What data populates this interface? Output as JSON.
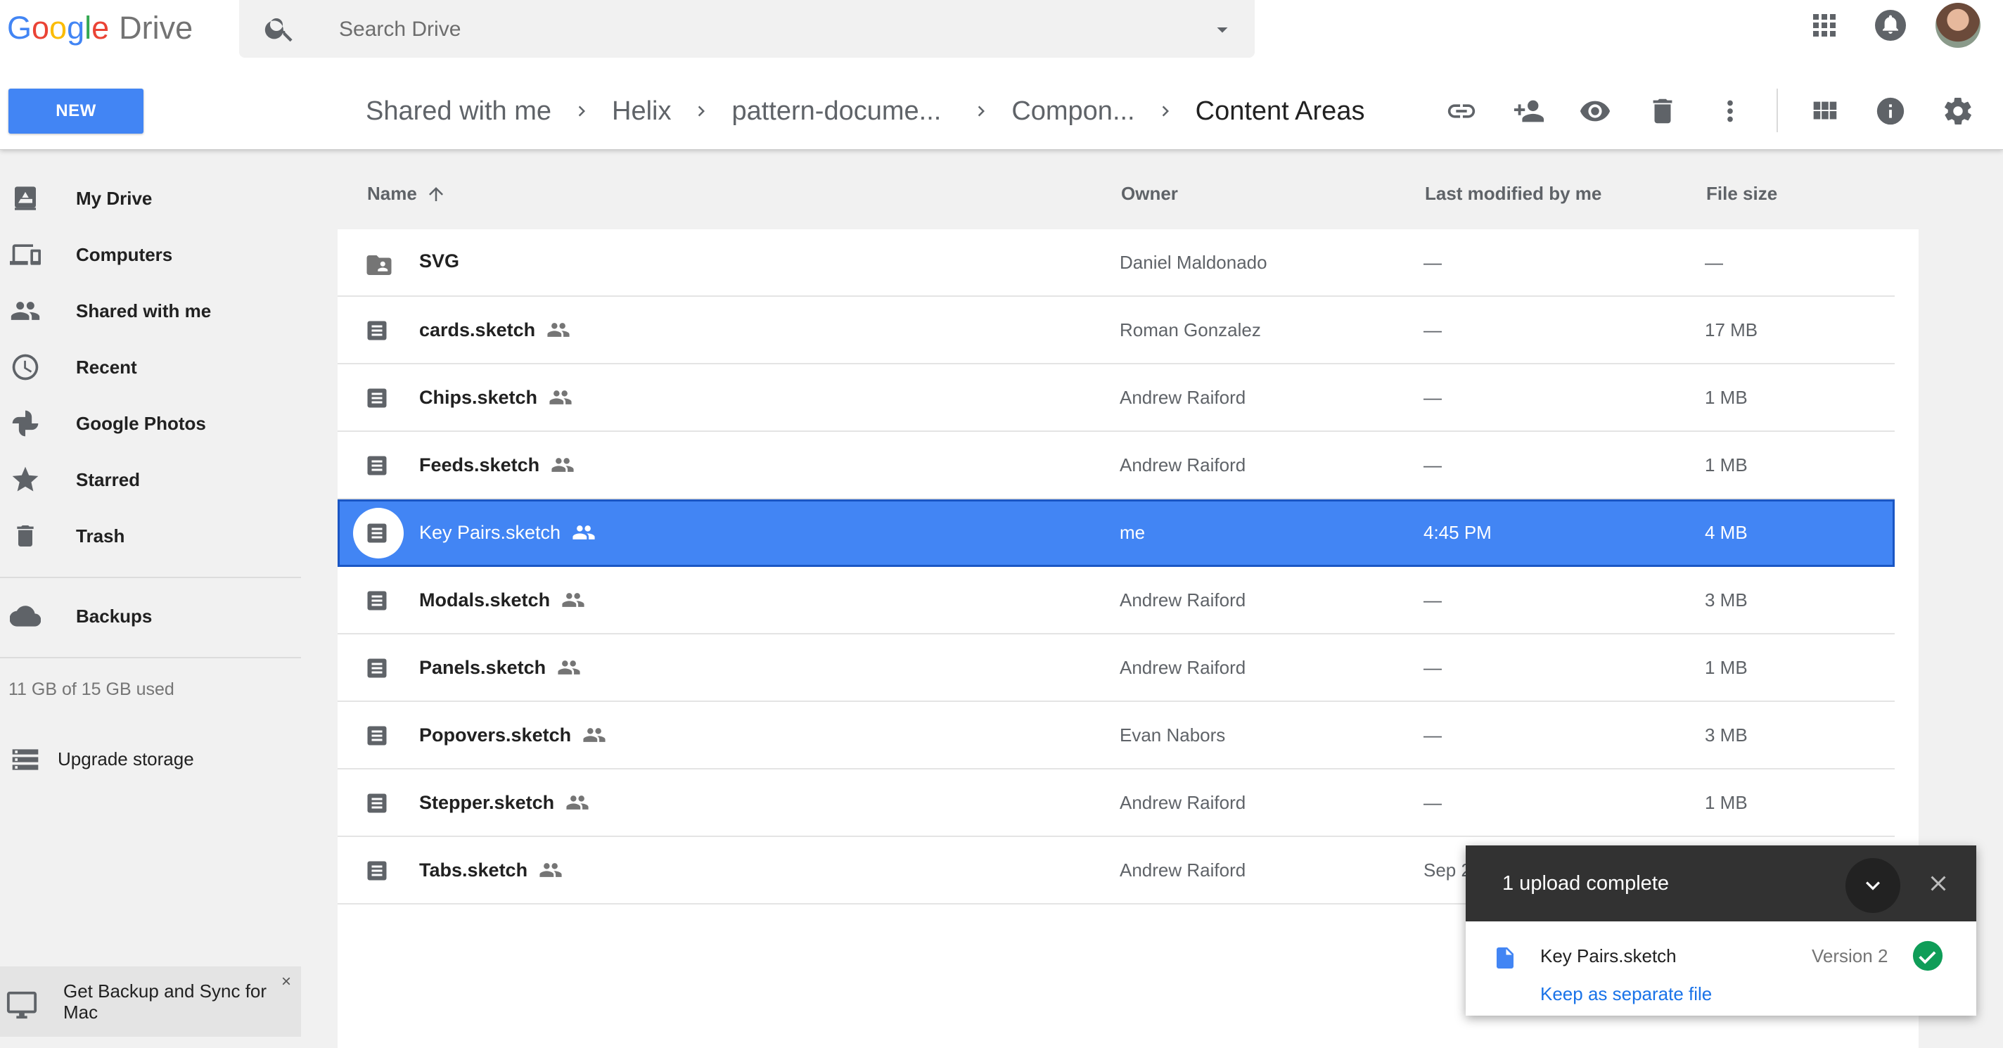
{
  "header": {
    "logo_text": "Google",
    "product_name": "Drive",
    "search_placeholder": "Search Drive"
  },
  "new_button_label": "NEW",
  "breadcrumb": [
    "Shared with me",
    "Helix",
    "pattern-docume...",
    "Compon...",
    "Content Areas"
  ],
  "toolbar_icons": [
    "link-icon",
    "add-person-icon",
    "preview-eye-icon",
    "trash-icon",
    "more-vert-icon",
    "grid-view-icon",
    "info-icon",
    "settings-gear-icon"
  ],
  "top_icons": [
    "apps-grid-icon",
    "notifications-bell-icon",
    "avatar"
  ],
  "sidebar": {
    "items": [
      {
        "label": "My Drive",
        "icon": "my-drive-icon"
      },
      {
        "label": "Computers",
        "icon": "computers-icon"
      },
      {
        "label": "Shared with me",
        "icon": "people-icon"
      },
      {
        "label": "Recent",
        "icon": "clock-icon"
      },
      {
        "label": "Google Photos",
        "icon": "pinwheel-icon"
      },
      {
        "label": "Starred",
        "icon": "star-icon"
      },
      {
        "label": "Trash",
        "icon": "trash-icon"
      }
    ],
    "backups_label": "Backups",
    "storage_text": "11 GB of 15 GB used",
    "upgrade_label": "Upgrade storage",
    "promo_text": "Get Backup and Sync for Mac",
    "promo_close": "×"
  },
  "columns": {
    "name": "Name",
    "owner": "Owner",
    "modified": "Last modified by me",
    "size": "File size"
  },
  "files": [
    {
      "name": "SVG",
      "owner": "Daniel Maldonado",
      "modified": "—",
      "size": "—",
      "type": "shared-folder",
      "shared": false,
      "selected": false
    },
    {
      "name": "cards.sketch",
      "owner": "Roman Gonzalez",
      "modified": "—",
      "size": "17 MB",
      "type": "file",
      "shared": true,
      "selected": false
    },
    {
      "name": "Chips.sketch",
      "owner": "Andrew Raiford",
      "modified": "—",
      "size": "1 MB",
      "type": "file",
      "shared": true,
      "selected": false
    },
    {
      "name": "Feeds.sketch",
      "owner": "Andrew Raiford",
      "modified": "—",
      "size": "1 MB",
      "type": "file",
      "shared": true,
      "selected": false
    },
    {
      "name": "Key Pairs.sketch",
      "owner": "me",
      "modified": "4:45 PM",
      "size": "4 MB",
      "type": "file",
      "shared": true,
      "selected": true
    },
    {
      "name": "Modals.sketch",
      "owner": "Andrew Raiford",
      "modified": "—",
      "size": "3 MB",
      "type": "file",
      "shared": true,
      "selected": false
    },
    {
      "name": "Panels.sketch",
      "owner": "Andrew Raiford",
      "modified": "—",
      "size": "1 MB",
      "type": "file",
      "shared": true,
      "selected": false
    },
    {
      "name": "Popovers.sketch",
      "owner": "Evan Nabors",
      "modified": "—",
      "size": "3 MB",
      "type": "file",
      "shared": true,
      "selected": false
    },
    {
      "name": "Stepper.sketch",
      "owner": "Andrew Raiford",
      "modified": "—",
      "size": "1 MB",
      "type": "file",
      "shared": true,
      "selected": false
    },
    {
      "name": "Tabs.sketch",
      "owner": "Andrew Raiford",
      "modified": "Sep 2",
      "size": "",
      "type": "file",
      "shared": true,
      "selected": false
    }
  ],
  "upload_panel": {
    "title": "1 upload complete",
    "file_name": "Key Pairs.sketch",
    "version": "Version 2",
    "action_link": "Keep as separate file"
  },
  "colors": {
    "accent": "#4285f4",
    "selected_row": "#4285f4",
    "upload_header": "#323232",
    "success": "#0f9d58",
    "link": "#1a73e8"
  }
}
